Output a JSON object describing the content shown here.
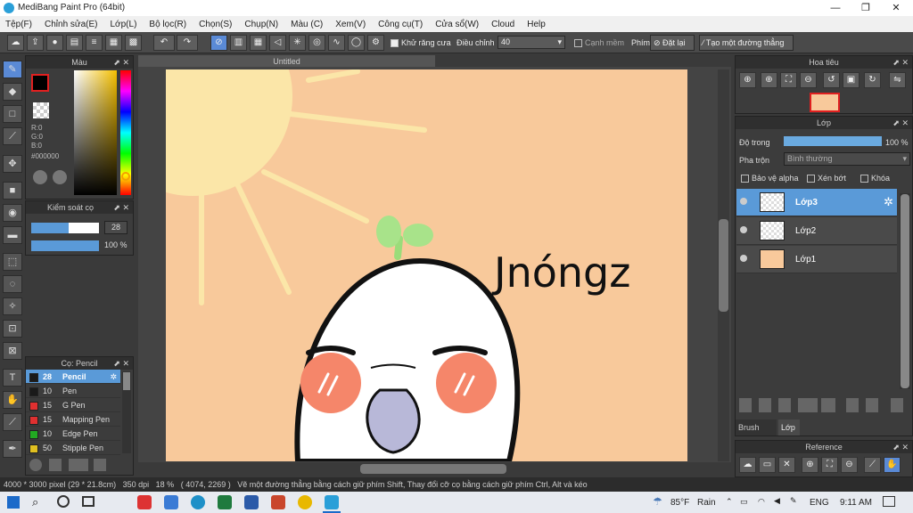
{
  "window": {
    "title": "MediBang Paint Pro (64bit)",
    "minimize": "—",
    "maximize": "❐",
    "close": "✕"
  },
  "menu": [
    "Tệp(F)",
    "Chỉnh sửa(E)",
    "Lớp(L)",
    "Bộ lọc(R)",
    "Chọn(S)",
    "Chụp(N)",
    "Màu (C)",
    "Xem(V)",
    "Công cụ(T)",
    "Cửa sổ(W)",
    "Cloud",
    "Help"
  ],
  "toolbar": {
    "antialias_label": "Khử răng cưa",
    "correction_label": "Điều chỉnh",
    "correction_value": "40",
    "soft_edge_label": "Cạnh mềm",
    "key_label": "Phím",
    "reset_label": "Đặt lại",
    "straight_line_label": "Tạo một đường thẳng"
  },
  "color_panel": {
    "title": "Màu",
    "r": "R:0",
    "g": "G:0",
    "b": "B:0",
    "hex": "#000000"
  },
  "brush_control": {
    "title": "Kiểm soát cọ",
    "size": "28",
    "opacity": "100 %",
    "size_fill": 0.55,
    "opacity_fill": 1.0
  },
  "brush_panel": {
    "title": "Cọ: Pencil",
    "items": [
      {
        "size": "28",
        "name": "Pencil",
        "color": "#1a1a1a",
        "selected": true
      },
      {
        "size": "10",
        "name": "Pen",
        "color": "#1a1a1a"
      },
      {
        "size": "15",
        "name": "G Pen",
        "color": "#e03030"
      },
      {
        "size": "15",
        "name": "Mapping Pen",
        "color": "#e03030"
      },
      {
        "size": "10",
        "name": "Edge Pen",
        "color": "#22aa22"
      },
      {
        "size": "50",
        "name": "Stipple Pen",
        "color": "#e0c020"
      }
    ]
  },
  "canvas": {
    "tab": "Untitled",
    "text": "Jnóngz"
  },
  "navigator": {
    "title": "Hoa tiêu"
  },
  "layer_panel": {
    "title": "Lớp",
    "opacity_label": "Độ trong",
    "opacity_value": "100 %",
    "opacity_fill": 1.0,
    "blend_label": "Pha trộn",
    "blend_value": "Bình thường",
    "protect_alpha": "Bảo vệ alpha",
    "clip": "Xén bớt",
    "lock": "Khóa",
    "layers": [
      {
        "name": "Lớp3",
        "selected": true
      },
      {
        "name": "Lớp2"
      },
      {
        "name": "Lớp1"
      }
    ],
    "tabs": [
      "Brush Size",
      "Lớp"
    ]
  },
  "reference": {
    "title": "Reference"
  },
  "status": {
    "size": "4000 * 3000 pixel",
    "cm": "(29 * 21.8cm)",
    "dpi": "350 dpi",
    "zoom": "18 %",
    "coords": "( 4074, 2269 )",
    "hint": "Vẽ một đường thẳng bằng cách giữ phím Shift, Thay đổi cỡ cọ bằng cách giữ phím Ctrl, Alt và kéo"
  },
  "taskbar": {
    "weather_temp": "85°F",
    "weather_text": "Rain",
    "lang": "ENG",
    "time": "9:11 AM"
  },
  "colors": {
    "accent": "#5a9ad8",
    "canvas_bg": "#f8c99b",
    "sun": "#fbe6a8",
    "red": "#e02020"
  }
}
